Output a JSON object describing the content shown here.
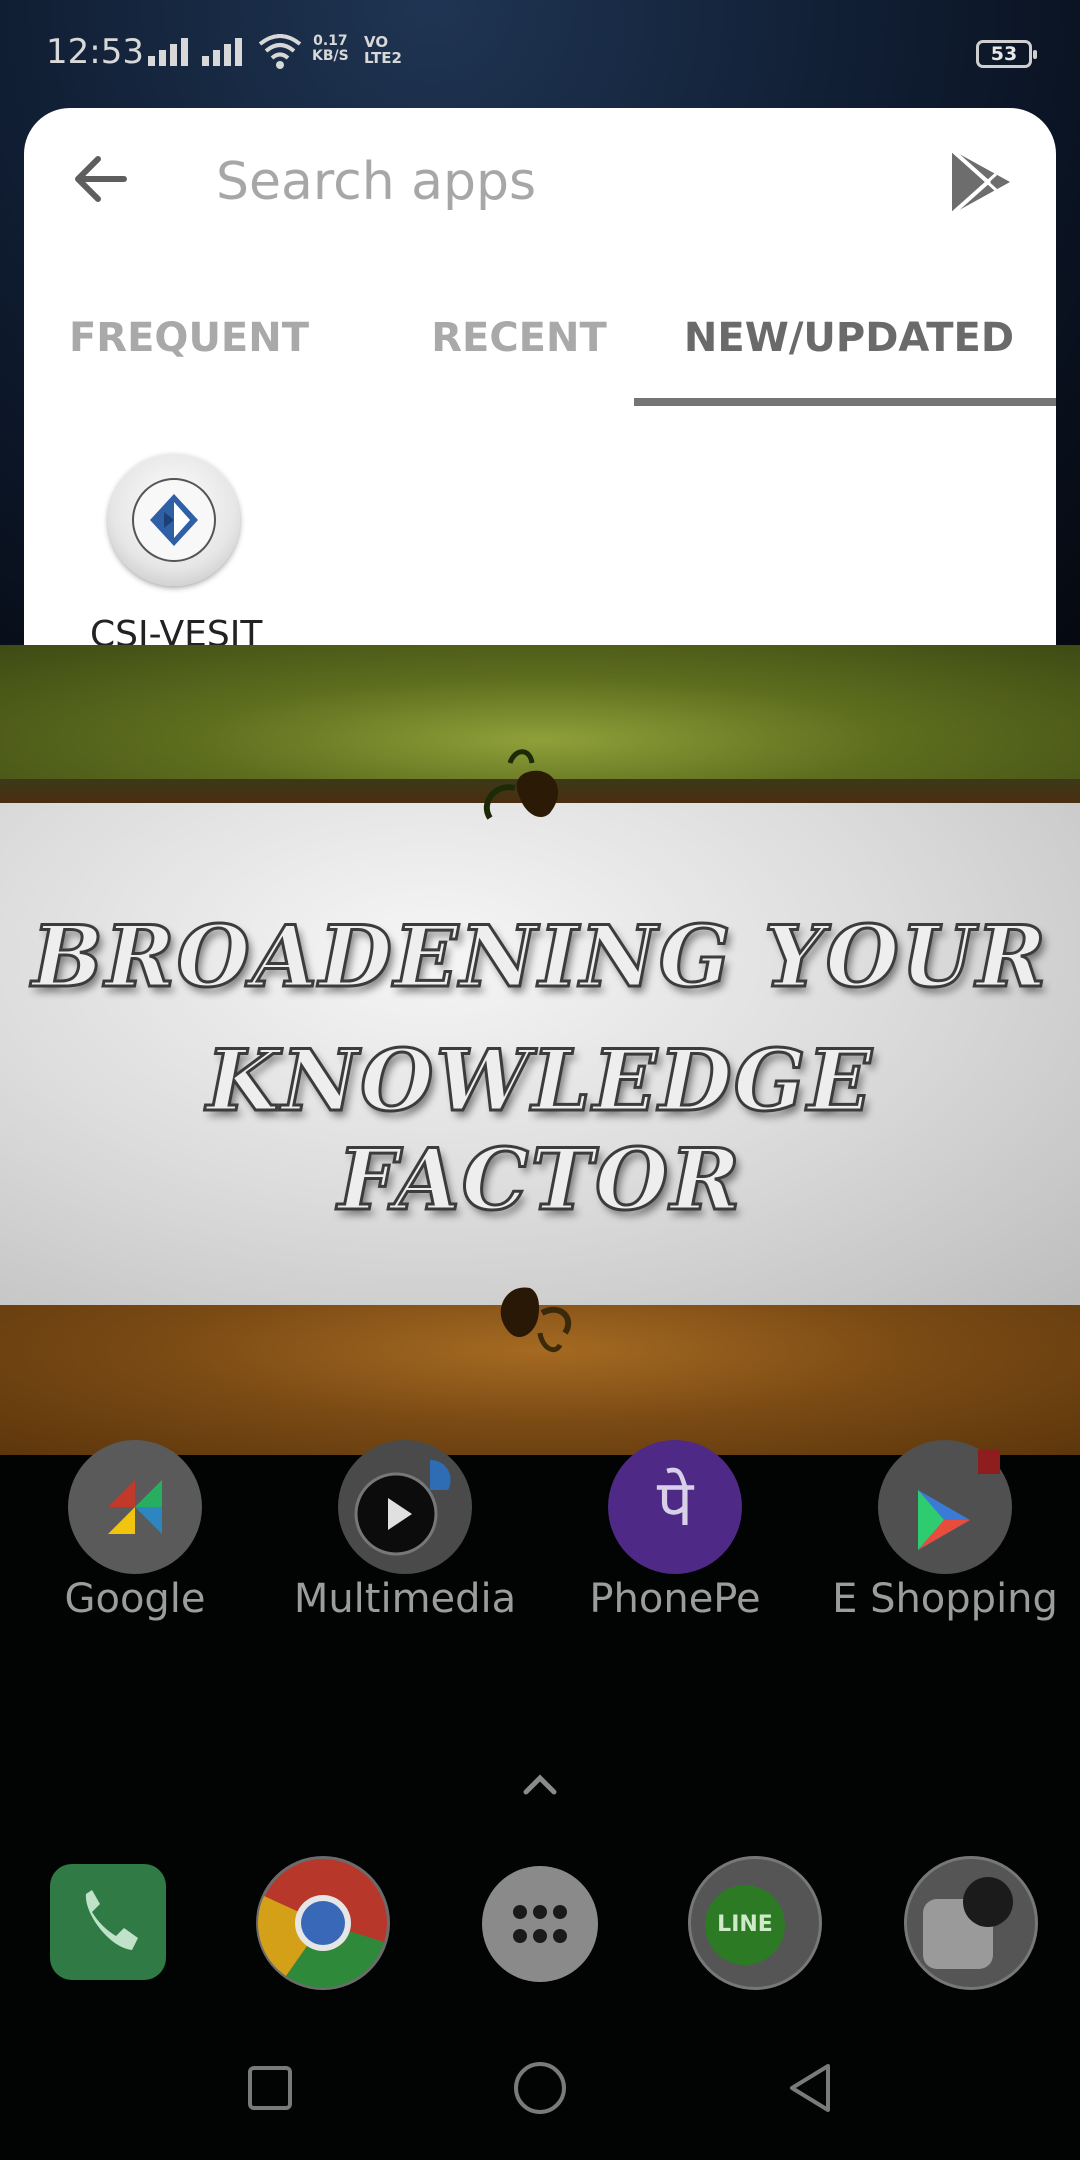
{
  "status_bar": {
    "time": "12:53",
    "net_speed_value": "0.17",
    "net_speed_unit": "KB/S",
    "volte_top": "VO",
    "volte_bottom": "LTE2",
    "battery": "53"
  },
  "drawer": {
    "search_placeholder": "Search apps",
    "tabs": [
      {
        "label": "FREQUENT",
        "active": false
      },
      {
        "label": "RECENT",
        "active": false
      },
      {
        "label": "NEW/UPDATED",
        "active": true
      }
    ],
    "apps": [
      {
        "label": "CSI-VESIT",
        "icon": "csi-logo-icon"
      }
    ]
  },
  "banner": {
    "line1": "BROADENING YOUR",
    "line2": "KNOWLEDGE FACTOR"
  },
  "home": {
    "apps": [
      {
        "label": "Google",
        "icon": "google-folder-icon"
      },
      {
        "label": "Multimedia",
        "icon": "multimedia-folder-icon"
      },
      {
        "label": "PhonePe",
        "icon": "phonepe-icon",
        "glyph": "पे"
      },
      {
        "label": "E Shopping",
        "icon": "shopping-folder-icon"
      }
    ],
    "dock": [
      {
        "name": "phone",
        "icon": "phone-icon"
      },
      {
        "name": "chrome",
        "icon": "chrome-icon"
      },
      {
        "name": "app-drawer",
        "icon": "app-drawer-icon"
      },
      {
        "name": "line",
        "icon": "line-folder-icon",
        "glyph": "LINE"
      },
      {
        "name": "clock",
        "icon": "clock-folder-icon"
      }
    ]
  },
  "colors": {
    "accent_underline": "#757575",
    "phonepe_purple": "#5f259f",
    "phone_green": "#3fae5a"
  }
}
